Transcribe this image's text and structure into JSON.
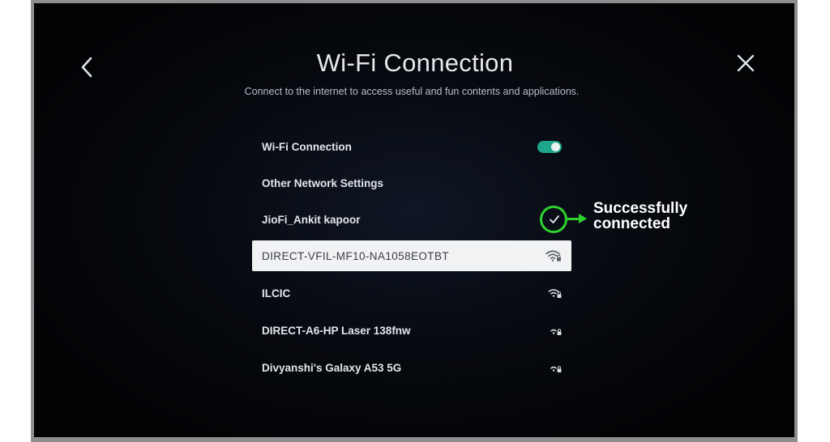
{
  "header": {
    "title": "Wi-Fi Connection",
    "subtitle": "Connect to the internet to access useful and fun contents and applications."
  },
  "settings": {
    "wifi_toggle_label": "Wi-Fi Connection",
    "wifi_toggle_on": true,
    "other_settings_label": "Other Network Settings"
  },
  "networks": [
    {
      "name": "JioFi_Ankit kapoor",
      "status": "connected",
      "icon": "check-icon"
    },
    {
      "name": "DIRECT-VFIL-MF10-NA1058EOTBT",
      "status": "selected",
      "icon": "wifi-lock-icon",
      "signal": 4
    },
    {
      "name": "ILCIC",
      "icon": "wifi-lock-icon",
      "signal": 3
    },
    {
      "name": "DIRECT-A6-HP Laser 138fnw",
      "icon": "wifi-lock-icon",
      "signal": 2
    },
    {
      "name": "Divyanshi's Galaxy A53 5G",
      "icon": "wifi-lock-icon",
      "signal": 2
    }
  ],
  "annotation": {
    "line1": "Successfully",
    "line2": "connected"
  },
  "colors": {
    "toggle_on": "#1fa68a",
    "annotation": "#2fd12f",
    "selected_row_bg": "#f1f2f4"
  }
}
